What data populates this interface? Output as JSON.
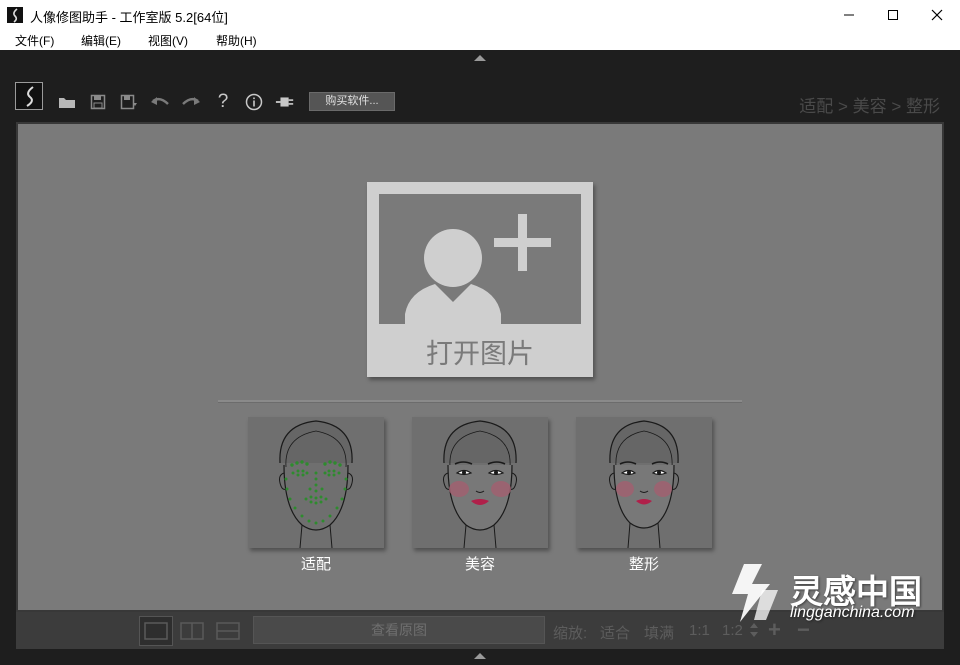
{
  "window": {
    "title": "人像修图助手 - 工作室版 5.2[64位]",
    "minimize": "minimize",
    "maximize": "maximize",
    "close": "close"
  },
  "menu": [
    "文件(F)",
    "编辑(E)",
    "视图(V)",
    "帮助(H)"
  ],
  "toolbar": {
    "icons": [
      "app-logo-icon",
      "open-folder-icon",
      "save-icon",
      "save-as-icon",
      "undo-icon",
      "redo-icon",
      "help-icon",
      "info-icon",
      "plugin-icon"
    ],
    "buy_label": "购买软件...",
    "breadcrumb": "适配 > 美容 > 整形"
  },
  "workspace": {
    "open_label": "打开图片",
    "modes": [
      {
        "label": "适配"
      },
      {
        "label": "美容"
      },
      {
        "label": "整形"
      }
    ]
  },
  "bottombar": {
    "view_original": "查看原图",
    "zoom_label": "缩放:",
    "fit": "适合",
    "fill": "填满",
    "ratio_1_1": "1:1",
    "ratio_1_2": "1:2",
    "zoom_in": "+",
    "zoom_out": "−"
  },
  "watermark": {
    "name": "灵感中国",
    "url": "lingganchina.com"
  },
  "colors": {
    "background": "#1e1e1e",
    "workspace": "#7a7a7a",
    "card": "#cfcfcf",
    "landmark": "#2e8b2e",
    "lips": "#b0204a"
  }
}
